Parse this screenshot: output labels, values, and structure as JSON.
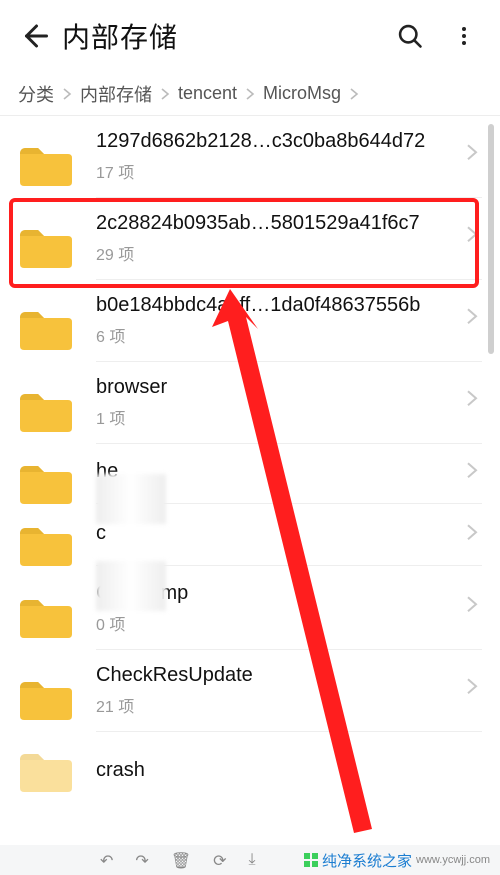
{
  "header": {
    "title": "内部存储"
  },
  "breadcrumb": {
    "items": [
      "分类",
      "内部存储",
      "tencent",
      "MicroMsg"
    ]
  },
  "list": {
    "item_suffix": "项",
    "rows": [
      {
        "name": "1297d6862b2128…c3c0ba8b644d72",
        "count": "17 项"
      },
      {
        "name": "2c28824b0935ab…5801529a41f6c7",
        "count": "29 项",
        "highlighted": true
      },
      {
        "name": "b0e184bbdc4a1ff…1da0f48637556b",
        "count": "6 项"
      },
      {
        "name": "browser",
        "count": "1 项"
      },
      {
        "name": "    he",
        "count": " "
      },
      {
        "name": "c",
        "count": " "
      },
      {
        "name": "CDNTemp",
        "count": "0 项"
      },
      {
        "name": "CheckResUpdate",
        "count": "21 项"
      },
      {
        "name": "crash",
        "count": ""
      }
    ]
  },
  "watermark": {
    "brand": "纯净系统之家",
    "url": "www.ycwjj.com"
  },
  "icons": {
    "back": "back-arrow-icon",
    "search": "search-icon",
    "more": "more-vertical-icon",
    "folder": "folder-icon",
    "chevron": "chevron-right-icon"
  },
  "colors": {
    "folder": "#f7c23c",
    "highlight": "#ff1e1e",
    "chevron": "#c8c8c8",
    "subtext": "#999999"
  }
}
